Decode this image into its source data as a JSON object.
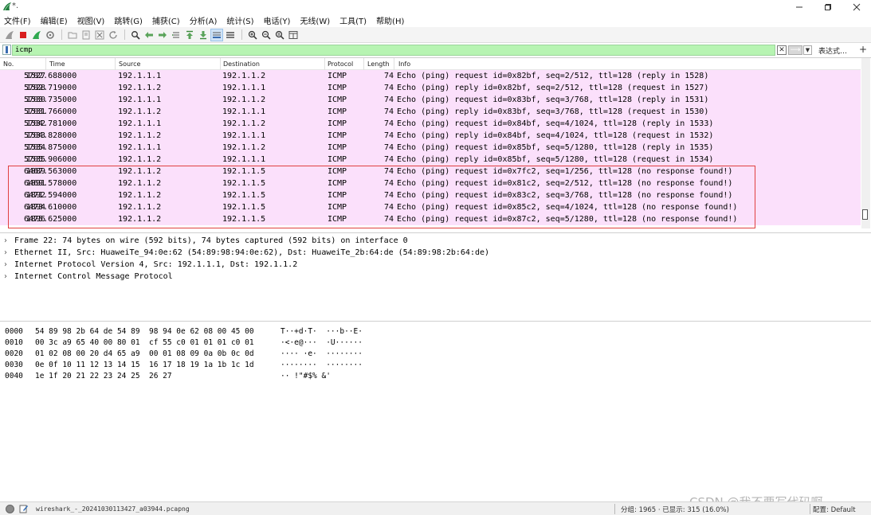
{
  "window": {
    "title": "*."
  },
  "menu": [
    "文件(F)",
    "编辑(E)",
    "视图(V)",
    "跳转(G)",
    "捕获(C)",
    "分析(A)",
    "统计(S)",
    "电话(Y)",
    "无线(W)",
    "工具(T)",
    "帮助(H)"
  ],
  "filter": {
    "value": "icmp",
    "expression_label": "表达式…",
    "add_label": "+"
  },
  "columns": {
    "no": "No.",
    "time": "Time",
    "source": "Source",
    "destination": "Destination",
    "protocol": "Protocol",
    "length": "Length",
    "info": "Info"
  },
  "packets": [
    {
      "no": "1527",
      "time": "5702.688000",
      "src": "192.1.1.1",
      "dst": "192.1.1.2",
      "proto": "ICMP",
      "len": "74",
      "info": "Echo (ping) request  id=0x82bf, seq=2/512, ttl=128 (reply in 1528)"
    },
    {
      "no": "1528",
      "time": "5702.719000",
      "src": "192.1.1.2",
      "dst": "192.1.1.1",
      "proto": "ICMP",
      "len": "74",
      "info": "Echo (ping) reply    id=0x82bf, seq=2/512, ttl=128 (request in 1527)"
    },
    {
      "no": "1530",
      "time": "5703.735000",
      "src": "192.1.1.1",
      "dst": "192.1.1.2",
      "proto": "ICMP",
      "len": "74",
      "info": "Echo (ping) request  id=0x83bf, seq=3/768, ttl=128 (reply in 1531)"
    },
    {
      "no": "1531",
      "time": "5703.766000",
      "src": "192.1.1.2",
      "dst": "192.1.1.1",
      "proto": "ICMP",
      "len": "74",
      "info": "Echo (ping) reply    id=0x83bf, seq=3/768, ttl=128 (request in 1530)"
    },
    {
      "no": "1532",
      "time": "5704.781000",
      "src": "192.1.1.1",
      "dst": "192.1.1.2",
      "proto": "ICMP",
      "len": "74",
      "info": "Echo (ping) request  id=0x84bf, seq=4/1024, ttl=128 (reply in 1533)"
    },
    {
      "no": "1533",
      "time": "5704.828000",
      "src": "192.1.1.2",
      "dst": "192.1.1.1",
      "proto": "ICMP",
      "len": "74",
      "info": "Echo (ping) reply    id=0x84bf, seq=4/1024, ttl=128 (request in 1532)"
    },
    {
      "no": "1534",
      "time": "5705.875000",
      "src": "192.1.1.1",
      "dst": "192.1.1.2",
      "proto": "ICMP",
      "len": "74",
      "info": "Echo (ping) request  id=0x85bf, seq=5/1280, ttl=128 (reply in 1535)"
    },
    {
      "no": "1535",
      "time": "5705.906000",
      "src": "192.1.1.2",
      "dst": "192.1.1.1",
      "proto": "ICMP",
      "len": "74",
      "info": "Echo (ping) reply    id=0x85bf, seq=5/1280, ttl=128 (request in 1534)"
    },
    {
      "no": "1889",
      "time": "6467.563000",
      "src": "192.1.1.2",
      "dst": "192.1.1.5",
      "proto": "ICMP",
      "len": "74",
      "info": "Echo (ping) request  id=0x7fc2, seq=1/256, ttl=128 (no response found!)"
    },
    {
      "no": "1891",
      "time": "6469.578000",
      "src": "192.1.1.2",
      "dst": "192.1.1.5",
      "proto": "ICMP",
      "len": "74",
      "info": "Echo (ping) request  id=0x81c2, seq=2/512, ttl=128 (no response found!)"
    },
    {
      "no": "1892",
      "time": "6471.594000",
      "src": "192.1.1.2",
      "dst": "192.1.1.5",
      "proto": "ICMP",
      "len": "74",
      "info": "Echo (ping) request  id=0x83c2, seq=3/768, ttl=128 (no response found!)"
    },
    {
      "no": "1894",
      "time": "6473.610000",
      "src": "192.1.1.2",
      "dst": "192.1.1.5",
      "proto": "ICMP",
      "len": "74",
      "info": "Echo (ping) request  id=0x85c2, seq=4/1024, ttl=128 (no response found!)"
    },
    {
      "no": "1896",
      "time": "6475.625000",
      "src": "192.1.1.2",
      "dst": "192.1.1.5",
      "proto": "ICMP",
      "len": "74",
      "info": "Echo (ping) request  id=0x87c2, seq=5/1280, ttl=128 (no response found!)"
    }
  ],
  "details": [
    "Frame 22: 74 bytes on wire (592 bits), 74 bytes captured (592 bits) on interface 0",
    "Ethernet II, Src: HuaweiTe_94:0e:62 (54:89:98:94:0e:62), Dst: HuaweiTe_2b:64:de (54:89:98:2b:64:de)",
    "Internet Protocol Version 4, Src: 192.1.1.1, Dst: 192.1.1.2",
    "Internet Control Message Protocol"
  ],
  "bytes": [
    {
      "offset": "0000",
      "hex": "54 89 98 2b 64 de 54 89  98 94 0e 62 08 00 45 00",
      "ascii": "T··+d·T·  ···b··E·"
    },
    {
      "offset": "0010",
      "hex": "00 3c a9 65 40 00 80 01  cf 55 c0 01 01 01 c0 01",
      "ascii": "·<·e@···  ·U······"
    },
    {
      "offset": "0020",
      "hex": "01 02 08 00 20 d4 65 a9  00 01 08 09 0a 0b 0c 0d",
      "ascii": "···· ·e·  ········"
    },
    {
      "offset": "0030",
      "hex": "0e 0f 10 11 12 13 14 15  16 17 18 19 1a 1b 1c 1d",
      "ascii": "········  ········"
    },
    {
      "offset": "0040",
      "hex": "1e 1f 20 21 22 23 24 25  26 27",
      "ascii": "·· !\"#$% &'"
    }
  ],
  "status": {
    "file": "wireshark_-_20241030113427_a03944.pcapng",
    "counts": "分组: 1965 · 已显示: 315 (16.0%)",
    "profile": "配置: Default"
  },
  "watermark": "CSDN @我不要写代码啊",
  "colors": {
    "row_bg": "#fbe0fb",
    "filter_bg": "#b7f4b2",
    "highlight_border": "#e04040"
  },
  "icons": [
    "wireshark-fin-icon",
    "minimize-icon",
    "maximize-icon",
    "close-icon"
  ]
}
